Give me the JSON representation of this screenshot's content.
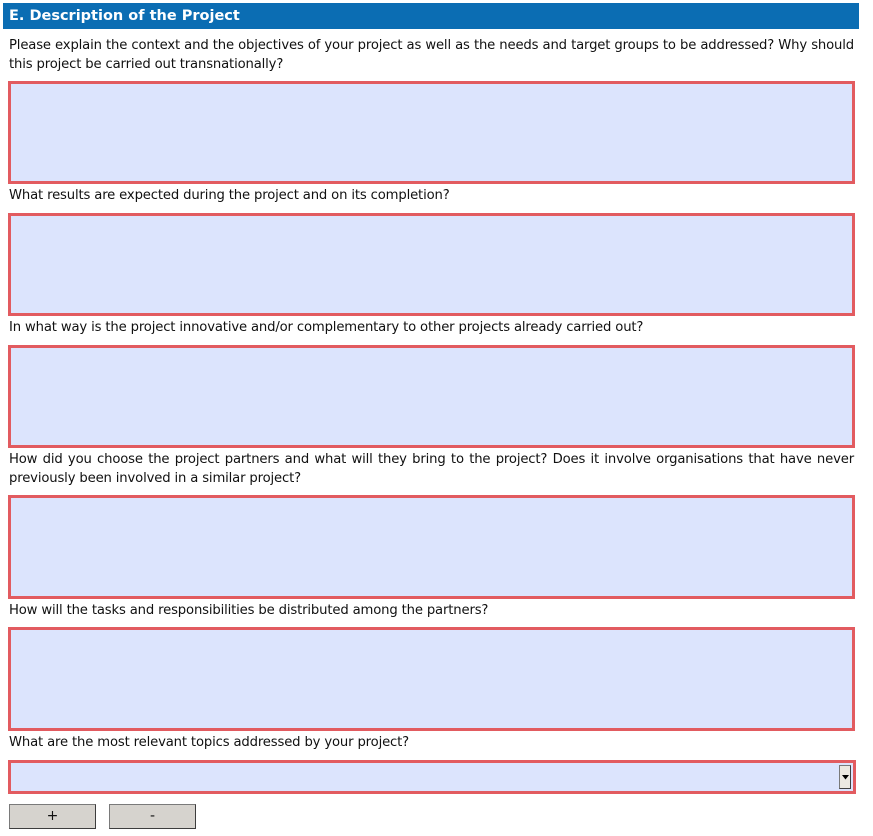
{
  "section": {
    "title": "E. Description of the Project"
  },
  "questions": [
    {
      "label": "Please explain the context and the objectives of your project as well as the needs and target groups to be addressed? Why should this project be carried out transnationally?",
      "value": ""
    },
    {
      "label": "What results are expected during the project and on its completion?",
      "value": ""
    },
    {
      "label": "In what way is the project innovative and/or complementary to other projects already carried out?",
      "value": ""
    },
    {
      "label": "How did you choose the project partners and what will they bring to the project? Does it involve organisations that have never previously been involved in a similar project?",
      "value": ""
    },
    {
      "label": "How will the tasks and responsibilities be distributed among the partners?",
      "value": ""
    }
  ],
  "topics": {
    "label": "What are the most relevant topics addressed by your project?",
    "selected": ""
  },
  "buttons": {
    "add_label": "+",
    "remove_label": "-"
  },
  "colors": {
    "header_bg": "#0b6db3",
    "field_bg": "#dce4fd",
    "field_border": "#e25b60"
  }
}
